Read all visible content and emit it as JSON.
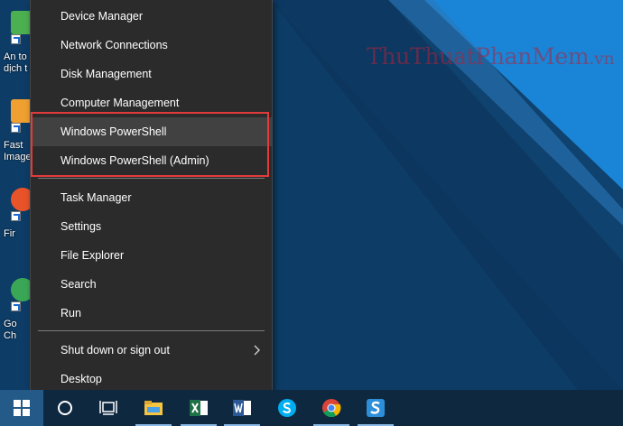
{
  "watermark": {
    "main": "ThuThuatPhanMem",
    "suffix": ".vn"
  },
  "desktop_icons": [
    {
      "name": "desktop-icon-an-toan",
      "line1": "An to",
      "line2": "dịch t",
      "color": "#4caf50"
    },
    {
      "name": "desktop-icon-faststone",
      "line1": "Fast",
      "line2": "Image",
      "color": "#f0a030"
    },
    {
      "name": "desktop-icon-firefox",
      "line1": "Fir",
      "line2": "",
      "color": "#e8532a"
    },
    {
      "name": "desktop-icon-chrome",
      "line1": "Go",
      "line2": "Ch",
      "color": "#3aa757"
    }
  ],
  "menu": {
    "items": [
      {
        "label": "Device Manager",
        "name": "menu-item-device-manager"
      },
      {
        "label": "Network Connections",
        "name": "menu-item-network-connections"
      },
      {
        "label": "Disk Management",
        "name": "menu-item-disk-management"
      },
      {
        "label": "Computer Management",
        "name": "menu-item-computer-management"
      },
      {
        "label": "Windows PowerShell",
        "name": "menu-item-windows-powershell",
        "hover": true
      },
      {
        "label": "Windows PowerShell (Admin)",
        "name": "menu-item-windows-powershell-admin"
      },
      {
        "label": "Task Manager",
        "name": "menu-item-task-manager"
      },
      {
        "label": "Settings",
        "name": "menu-item-settings"
      },
      {
        "label": "File Explorer",
        "name": "menu-item-file-explorer"
      },
      {
        "label": "Search",
        "name": "menu-item-search"
      },
      {
        "label": "Run",
        "name": "menu-item-run"
      },
      {
        "label": "Shut down or sign out",
        "name": "menu-item-shut-down",
        "submenu": true
      },
      {
        "label": "Desktop",
        "name": "menu-item-desktop"
      }
    ]
  },
  "taskbar": {
    "items": [
      {
        "name": "start-button",
        "icon": "windows-logo-icon"
      },
      {
        "name": "cortana-button",
        "icon": "cortana-circle-icon"
      },
      {
        "name": "task-view-button",
        "icon": "task-view-icon"
      },
      {
        "name": "taskbar-file-explorer",
        "icon": "folder-icon",
        "running": true
      },
      {
        "name": "taskbar-excel",
        "icon": "excel-icon",
        "running": true
      },
      {
        "name": "taskbar-word",
        "icon": "word-icon",
        "running": true
      },
      {
        "name": "taskbar-skype",
        "icon": "skype-icon"
      },
      {
        "name": "taskbar-chrome",
        "icon": "chrome-icon",
        "running": true
      },
      {
        "name": "taskbar-snagit",
        "icon": "snagit-icon",
        "running": true
      }
    ]
  },
  "colors": {
    "menu_bg": "#2b2b2b",
    "menu_hover": "#414141",
    "highlight_box": "#e23b3b",
    "taskbar_bg": "#0e2840",
    "desktop_bg": "#10436f"
  }
}
